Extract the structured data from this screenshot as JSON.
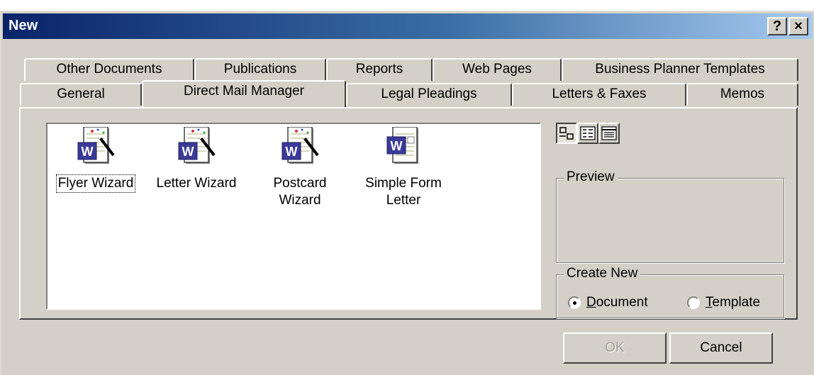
{
  "window": {
    "title": "New",
    "help_label": "?",
    "close_label": "×"
  },
  "tabs_back_row": [
    {
      "label": "Other Documents"
    },
    {
      "label": "Publications"
    },
    {
      "label": "Reports"
    },
    {
      "label": "Web Pages"
    },
    {
      "label": "Business Planner Templates"
    }
  ],
  "tabs_front_row": [
    {
      "label": "General"
    },
    {
      "label": "Direct Mail Manager",
      "active": true
    },
    {
      "label": "Legal Pleadings"
    },
    {
      "label": "Letters & Faxes"
    },
    {
      "label": "Memos"
    }
  ],
  "files": [
    {
      "label": "Flyer Wizard",
      "icon": "wizard-document-icon",
      "selected": true
    },
    {
      "label": "Letter Wizard",
      "icon": "wizard-document-icon"
    },
    {
      "label": "Postcard Wizard",
      "icon": "wizard-document-icon"
    },
    {
      "label": "Simple Form Letter",
      "icon": "word-document-icon"
    }
  ],
  "view_buttons": [
    {
      "icon": "large-icons-view-icon",
      "pressed": true
    },
    {
      "icon": "list-view-icon",
      "pressed": false
    },
    {
      "icon": "details-view-icon",
      "pressed": false
    }
  ],
  "preview": {
    "label": "Preview"
  },
  "create_new": {
    "label": "Create New",
    "options": [
      {
        "label_first": "D",
        "label_rest": "ocument",
        "checked": true
      },
      {
        "label_first": "T",
        "label_rest": "emplate",
        "checked": false
      }
    ]
  },
  "buttons": {
    "ok": "OK",
    "cancel": "Cancel"
  }
}
